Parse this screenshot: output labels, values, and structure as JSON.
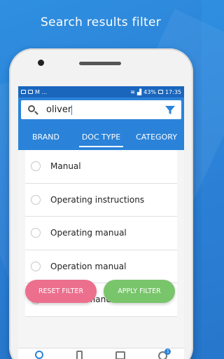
{
  "headline": "Search results filter",
  "statusbar": {
    "left_label": "M ...",
    "battery": "43%",
    "time": "17:35"
  },
  "search": {
    "value": "oliver",
    "placeholder": ""
  },
  "tabs": [
    {
      "label": "BRAND",
      "active": false
    },
    {
      "label": "DOC TYPE",
      "active": true
    },
    {
      "label": "CATEGORY",
      "active": false
    }
  ],
  "items": [
    {
      "label": "Manual"
    },
    {
      "label": "Operating instructions"
    },
    {
      "label": "Operating manual"
    },
    {
      "label": "Operation manual"
    },
    {
      "label": "Owner's manual"
    }
  ],
  "buttons": {
    "reset": "RESET FILTER",
    "apply": "APPLY FILTER"
  },
  "nav": {
    "settings_badge": "1"
  },
  "colors": {
    "primary": "#2a83d9",
    "statusbar": "#1a66bd",
    "reset": "#ec6f8d",
    "apply": "#79c56b"
  }
}
